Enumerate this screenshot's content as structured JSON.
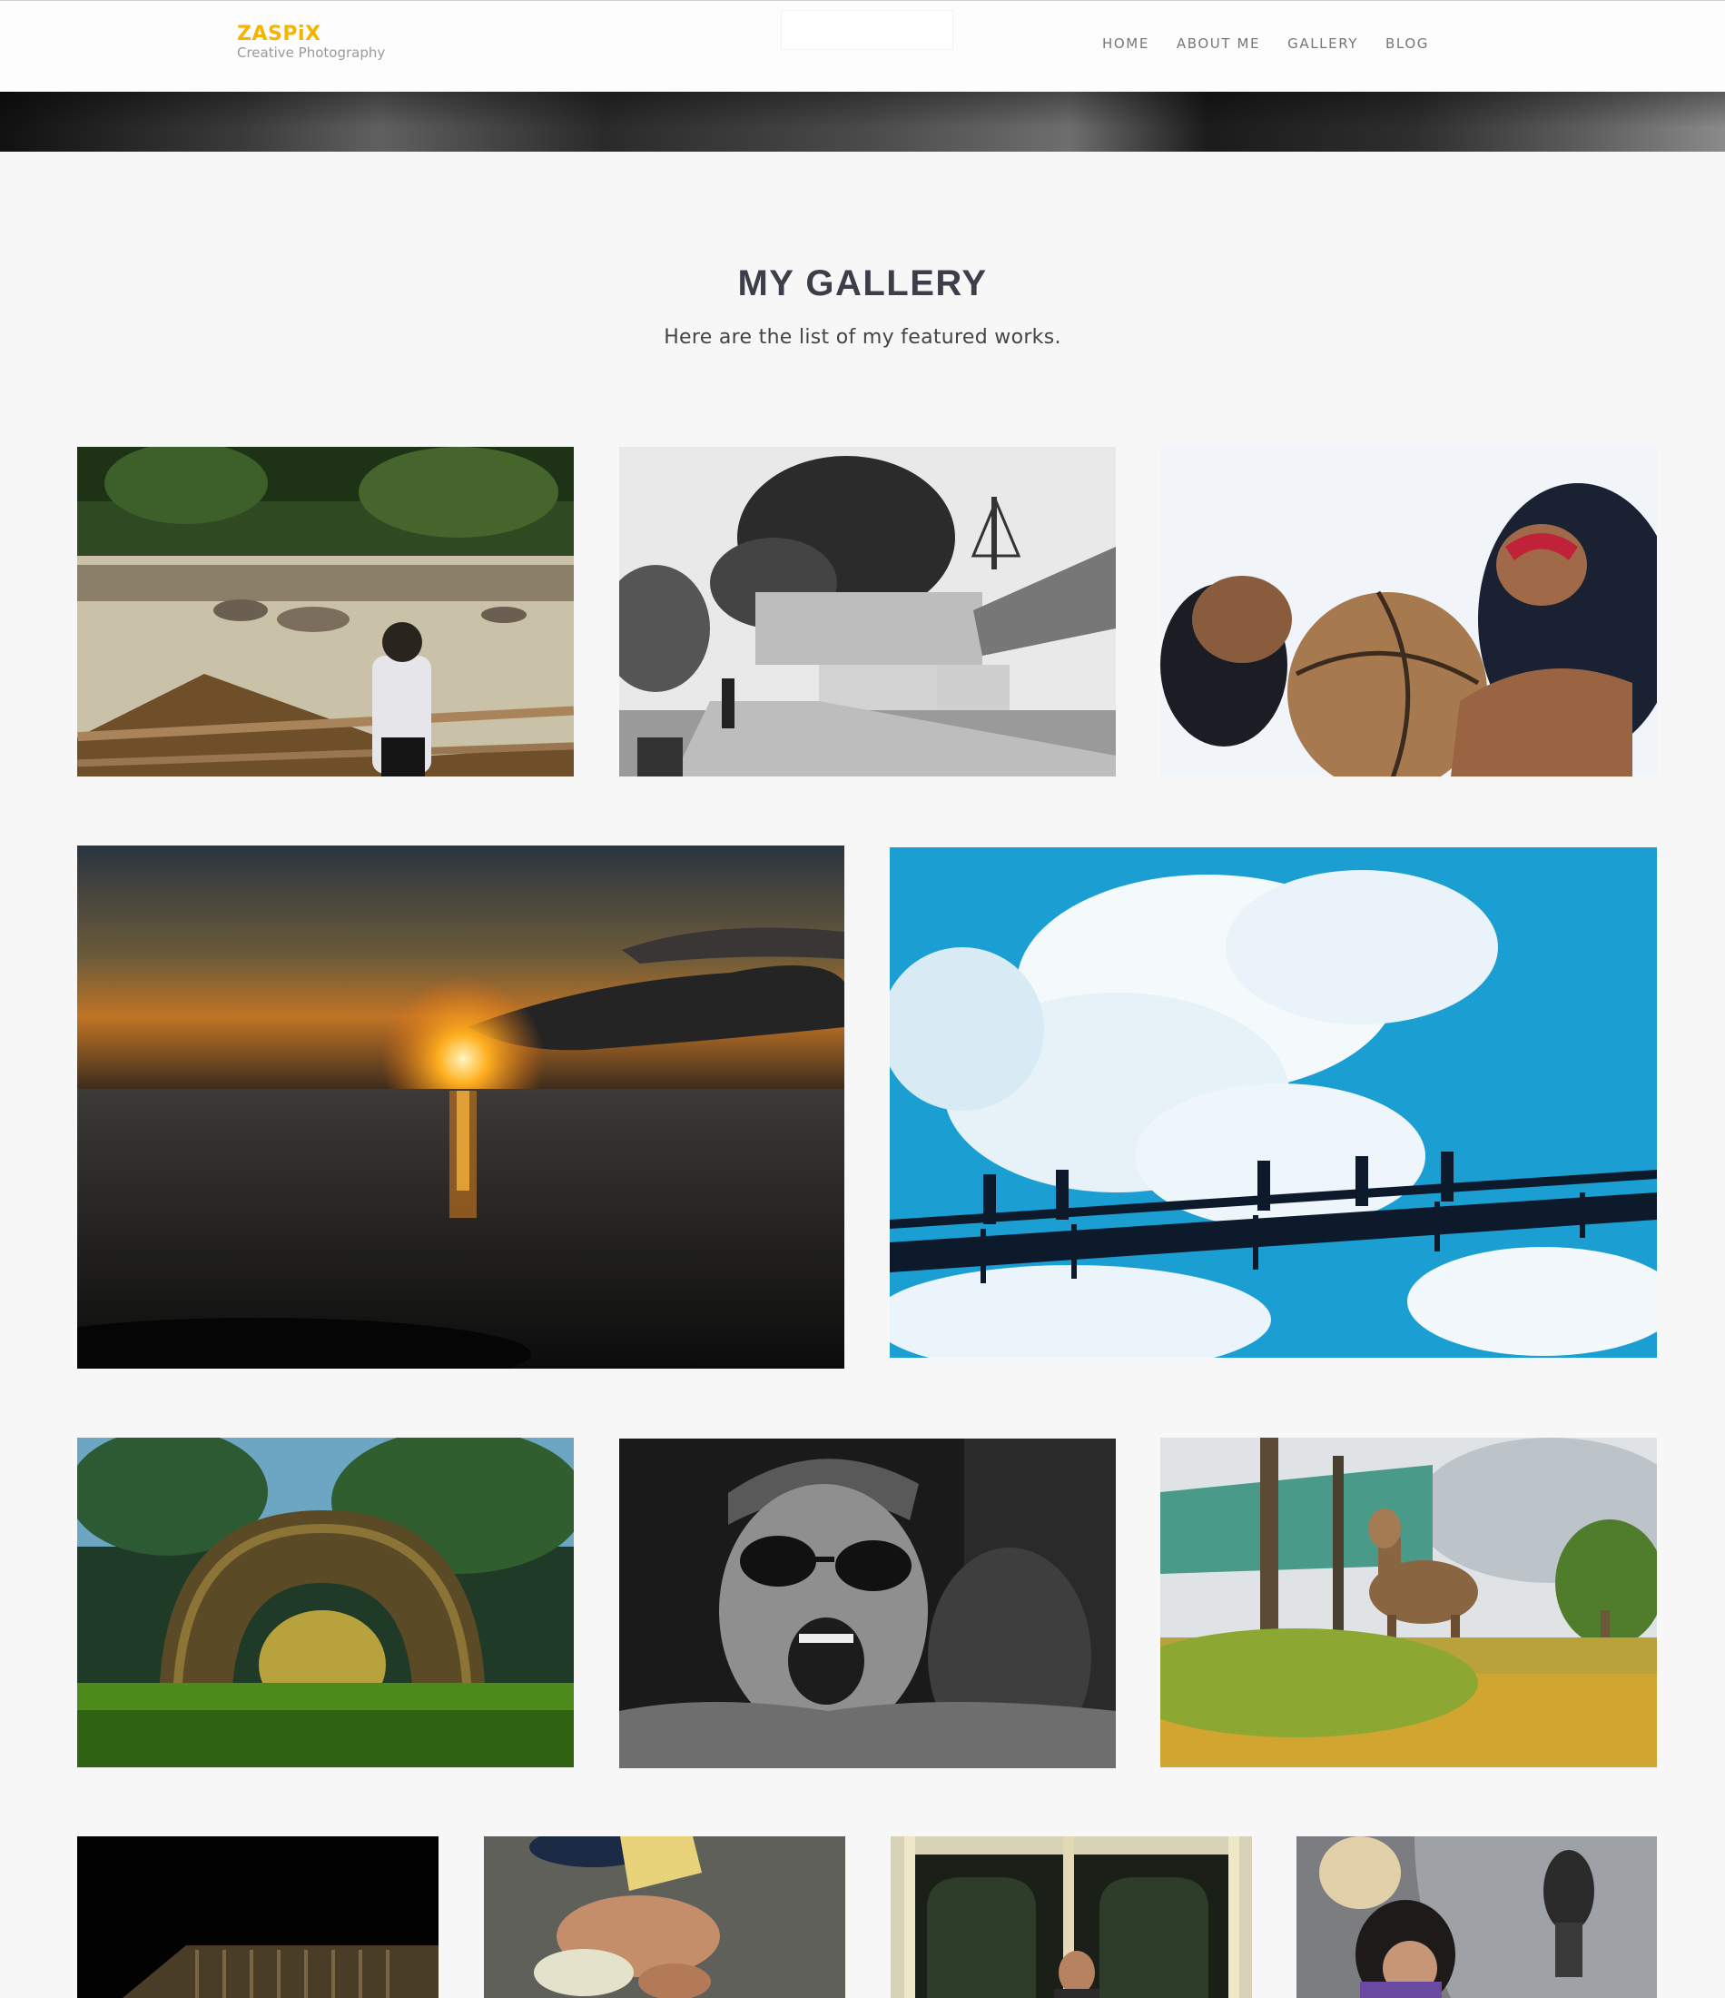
{
  "header": {
    "logo_title": "ZASPiX",
    "logo_subtitle": "Creative Photography",
    "nav": [
      {
        "label": "HOME"
      },
      {
        "label": "ABOUT ME"
      },
      {
        "label": "GALLERY"
      },
      {
        "label": "BLOG"
      }
    ]
  },
  "gallery": {
    "title": "MY GALLERY",
    "subtitle": "Here are the list of my featured works."
  },
  "colors": {
    "brand_accent": "#f5b400",
    "nav_text": "#777777",
    "page_background": "#f7f7f7",
    "heading_text": "#3c3f4a"
  },
  "photos": [
    {
      "subject": "child-by-river"
    },
    {
      "subject": "street-scene-bw"
    },
    {
      "subject": "kids-with-basketball"
    },
    {
      "subject": "sunset-over-sea"
    },
    {
      "subject": "people-on-bridge-sky"
    },
    {
      "subject": "tire-in-grass"
    },
    {
      "subject": "shouting-man-bw"
    },
    {
      "subject": "goat-in-field"
    },
    {
      "subject": "dark-roof"
    },
    {
      "subject": "child-feet"
    },
    {
      "subject": "jeepney-window"
    },
    {
      "subject": "girl-reflection"
    }
  ]
}
